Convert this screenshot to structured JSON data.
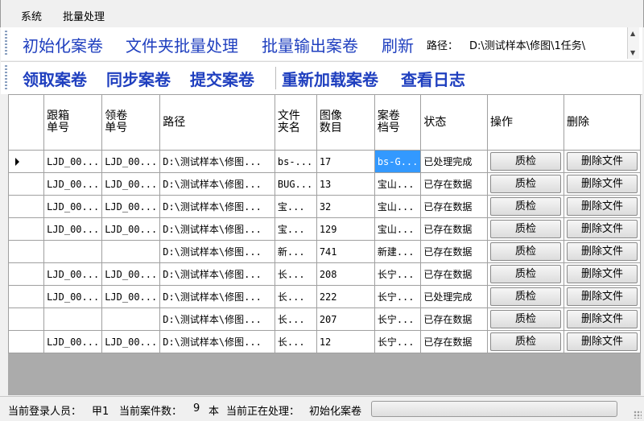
{
  "menu": {
    "items": [
      "系统",
      "批量处理"
    ]
  },
  "toolbar1": {
    "init": "初始化案卷",
    "folder_batch": "文件夹批量处理",
    "batch_output": "批量输出案卷",
    "refresh": "刷新",
    "path_label": "路径：",
    "path_value": "D:\\测试样本\\修图\\1任务\\"
  },
  "toolbar2": {
    "receive": "领取案卷",
    "sync": "同步案卷",
    "submit": "提交案卷",
    "reload": "重新加载案卷",
    "log": "查看日志"
  },
  "grid": {
    "headers": {
      "track_no": [
        "跟箱",
        "单号"
      ],
      "claim_no": [
        "领卷",
        "单号"
      ],
      "path": "路径",
      "folder": [
        "文件",
        "夹名"
      ],
      "images": [
        "图像",
        "数目"
      ],
      "case_no": [
        "案卷",
        "档号"
      ],
      "status": "状态",
      "action": "操作",
      "delete": "删除"
    },
    "rows": [
      {
        "track": "LJD_00...",
        "claim": "LJD_00...",
        "path": "D:\\测试样本\\修图...",
        "folder": "bs-...",
        "images": "17",
        "case": "bs-G...",
        "status": "已处理完成",
        "qc": "质检",
        "del": "删除文件"
      },
      {
        "track": "LJD_00...",
        "claim": "LJD_00...",
        "path": "D:\\测试样本\\修图...",
        "folder": "BUG...",
        "images": "13",
        "case": "宝山...",
        "status": "已存在数据",
        "qc": "质检",
        "del": "删除文件"
      },
      {
        "track": "LJD_00...",
        "claim": "LJD_00...",
        "path": "D:\\测试样本\\修图...",
        "folder": "宝...",
        "images": "32",
        "case": "宝山...",
        "status": "已存在数据",
        "qc": "质检",
        "del": "删除文件"
      },
      {
        "track": "LJD_00...",
        "claim": "LJD_00...",
        "path": "D:\\测试样本\\修图...",
        "folder": "宝...",
        "images": "129",
        "case": "宝山...",
        "status": "已存在数据",
        "qc": "质检",
        "del": "删除文件"
      },
      {
        "track": "",
        "claim": "",
        "path": "D:\\测试样本\\修图...",
        "folder": "新...",
        "images": "741",
        "case": "新建...",
        "status": "已存在数据",
        "qc": "质检",
        "del": "删除文件"
      },
      {
        "track": "LJD_00...",
        "claim": "LJD_00...",
        "path": "D:\\测试样本\\修图...",
        "folder": "长...",
        "images": "208",
        "case": "长宁...",
        "status": "已存在数据",
        "qc": "质检",
        "del": "删除文件"
      },
      {
        "track": "LJD_00...",
        "claim": "LJD_00...",
        "path": "D:\\测试样本\\修图...",
        "folder": "长...",
        "images": "222",
        "case": "长宁...",
        "status": "已处理完成",
        "qc": "质检",
        "del": "删除文件"
      },
      {
        "track": "",
        "claim": "",
        "path": "D:\\测试样本\\修图...",
        "folder": "长...",
        "images": "207",
        "case": "长宁...",
        "status": "已存在数据",
        "qc": "质检",
        "del": "删除文件"
      },
      {
        "track": "LJD_00...",
        "claim": "LJD_00...",
        "path": "D:\\测试样本\\修图...",
        "folder": "长...",
        "images": "12",
        "case": "长宁...",
        "status": "已存在数据",
        "qc": "质检",
        "del": "删除文件"
      }
    ]
  },
  "status": {
    "user_label": "当前登录人员：",
    "user": "甲1",
    "count_label": "当前案件数：",
    "count": "9",
    "count_unit": "本",
    "processing_label": "当前正在处理：",
    "processing": "初始化案卷",
    "progress": 0
  },
  "colors": {
    "accent": "#1f3fbf",
    "selection": "#3399ff"
  }
}
